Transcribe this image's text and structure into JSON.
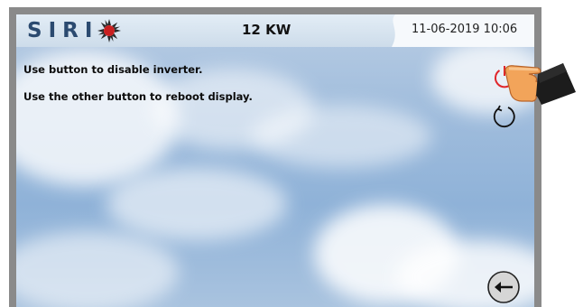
{
  "header": {
    "brand": "SIRI",
    "power": "12 KW",
    "datetime": "11-06-2019 10:06"
  },
  "messages": {
    "line1": "Use button to disable inverter.",
    "line2": "Use the other button to reboot display."
  },
  "buttons": {
    "power": {
      "icon": "power-icon",
      "color": "#e0262b"
    },
    "reboot": {
      "icon": "reboot-icon",
      "color": "#111111"
    },
    "back": {
      "icon": "back-arrow-icon"
    }
  },
  "colors": {
    "brand": "#2b4a70",
    "logo_sun": "#c91f1f",
    "header_bg": "#d8e4ef"
  }
}
